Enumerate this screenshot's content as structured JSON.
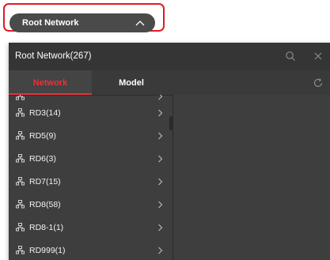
{
  "dropdown": {
    "label": "Root Network"
  },
  "panel": {
    "title": "Root Network(267)",
    "tabs": [
      {
        "label": "Network",
        "active": true
      },
      {
        "label": "Model",
        "active": false
      }
    ],
    "items": [
      {
        "label": "RD3(14)"
      },
      {
        "label": "RD5(9)"
      },
      {
        "label": "RD6(3)"
      },
      {
        "label": "RD7(15)"
      },
      {
        "label": "RD8(58)"
      },
      {
        "label": "RD8-1(1)"
      },
      {
        "label": "RD999(1)"
      }
    ]
  },
  "icons": {
    "dropdown": "chevron-up-icon",
    "search": "search-icon",
    "close": "close-icon",
    "refresh": "refresh-icon",
    "item": "network-tree-icon",
    "item_arrow": "chevron-right-icon"
  },
  "colors": {
    "highlight": "#e01a22",
    "active_tab": "#e8323a",
    "panel_bg": "#3e3e3e",
    "header_bg": "#353535",
    "pill_bg": "#4a4a4a"
  }
}
